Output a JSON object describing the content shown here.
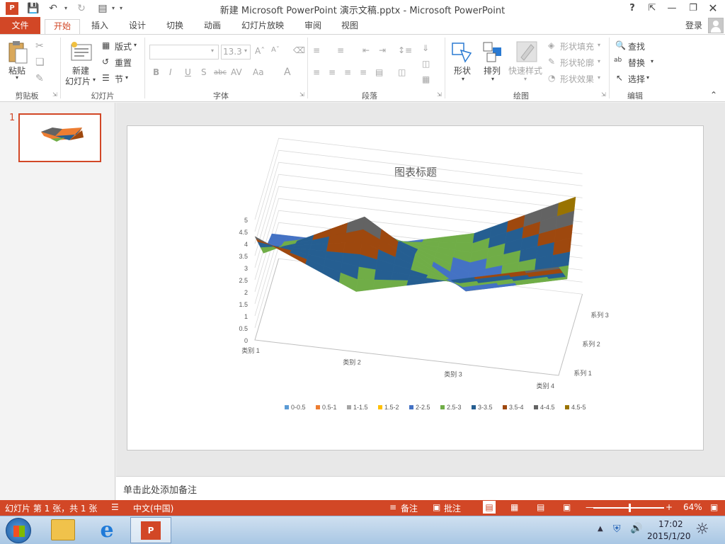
{
  "window": {
    "title": "新建 Microsoft PowerPoint 演示文稿.pptx - Microsoft PowerPoint",
    "help": "?",
    "login": "登录"
  },
  "tabs": [
    "文件",
    "开始",
    "插入",
    "设计",
    "切换",
    "动画",
    "幻灯片放映",
    "审阅",
    "视图"
  ],
  "ribbon": {
    "clipboard": {
      "paste": "粘贴",
      "label": "剪贴板"
    },
    "slides": {
      "new_line1": "新建",
      "new_line2": "幻灯片",
      "layout": "版式",
      "reset": "重置",
      "section": "节",
      "label": "幻灯片"
    },
    "font": {
      "size": "13.3",
      "label": "字体",
      "bold": "B",
      "italic": "I",
      "underline": "U",
      "shadow": "S",
      "strike": "abc",
      "spacing": "AV",
      "case": "Aa",
      "color": "A"
    },
    "paragraph": {
      "label": "段落"
    },
    "drawing": {
      "shapes": "形状",
      "arrange": "排列",
      "quick_styles": "快速样式",
      "fill": "形状填充",
      "outline": "形状轮廓",
      "effects": "形状效果",
      "label": "绘图"
    },
    "editing": {
      "find": "查找",
      "replace": "替换",
      "select": "选择",
      "label": "编辑"
    }
  },
  "thumbs": [
    {
      "num": "1"
    }
  ],
  "chart_data": {
    "type": "surface",
    "title": "图表标题",
    "categories": [
      "类别 1",
      "类别 2",
      "类别 3",
      "类别 4"
    ],
    "series": [
      {
        "name": "系列 1",
        "values": [
          4.3,
          2.5,
          3.5,
          4.5
        ]
      },
      {
        "name": "系列 2",
        "values": [
          2.4,
          4.4,
          1.8,
          2.8
        ]
      },
      {
        "name": "系列 3",
        "values": [
          2.0,
          2.0,
          3.0,
          5.0
        ]
      }
    ],
    "zlim": [
      0,
      5
    ],
    "z_ticks": [
      "0",
      "0.5",
      "1",
      "1.5",
      "2",
      "2.5",
      "3",
      "3.5",
      "4",
      "4.5",
      "5"
    ],
    "legend": [
      {
        "label": "0-0.5",
        "color": "#5b9bd5"
      },
      {
        "label": "0.5-1",
        "color": "#ed7d31"
      },
      {
        "label": "1-1.5",
        "color": "#a5a5a5"
      },
      {
        "label": "1.5-2",
        "color": "#ffc000"
      },
      {
        "label": "2-2.5",
        "color": "#4472c4"
      },
      {
        "label": "2.5-3",
        "color": "#70ad47"
      },
      {
        "label": "3-3.5",
        "color": "#255e91"
      },
      {
        "label": "3.5-4",
        "color": "#9e480e"
      },
      {
        "label": "4-4.5",
        "color": "#636363"
      },
      {
        "label": "4.5-5",
        "color": "#997300"
      }
    ],
    "legend_position": "bottom"
  },
  "notes_placeholder": "单击此处添加备注",
  "status": {
    "slide_info": "幻灯片 第 1 张，共 1 张",
    "language": "中文(中国)",
    "notes": "备注",
    "comments": "批注",
    "zoom": "64%",
    "zoom_value": 0.64
  },
  "taskbar": {
    "time": "17:02",
    "date": "2015/1/20"
  },
  "colors": {
    "accent": "#d24726"
  }
}
